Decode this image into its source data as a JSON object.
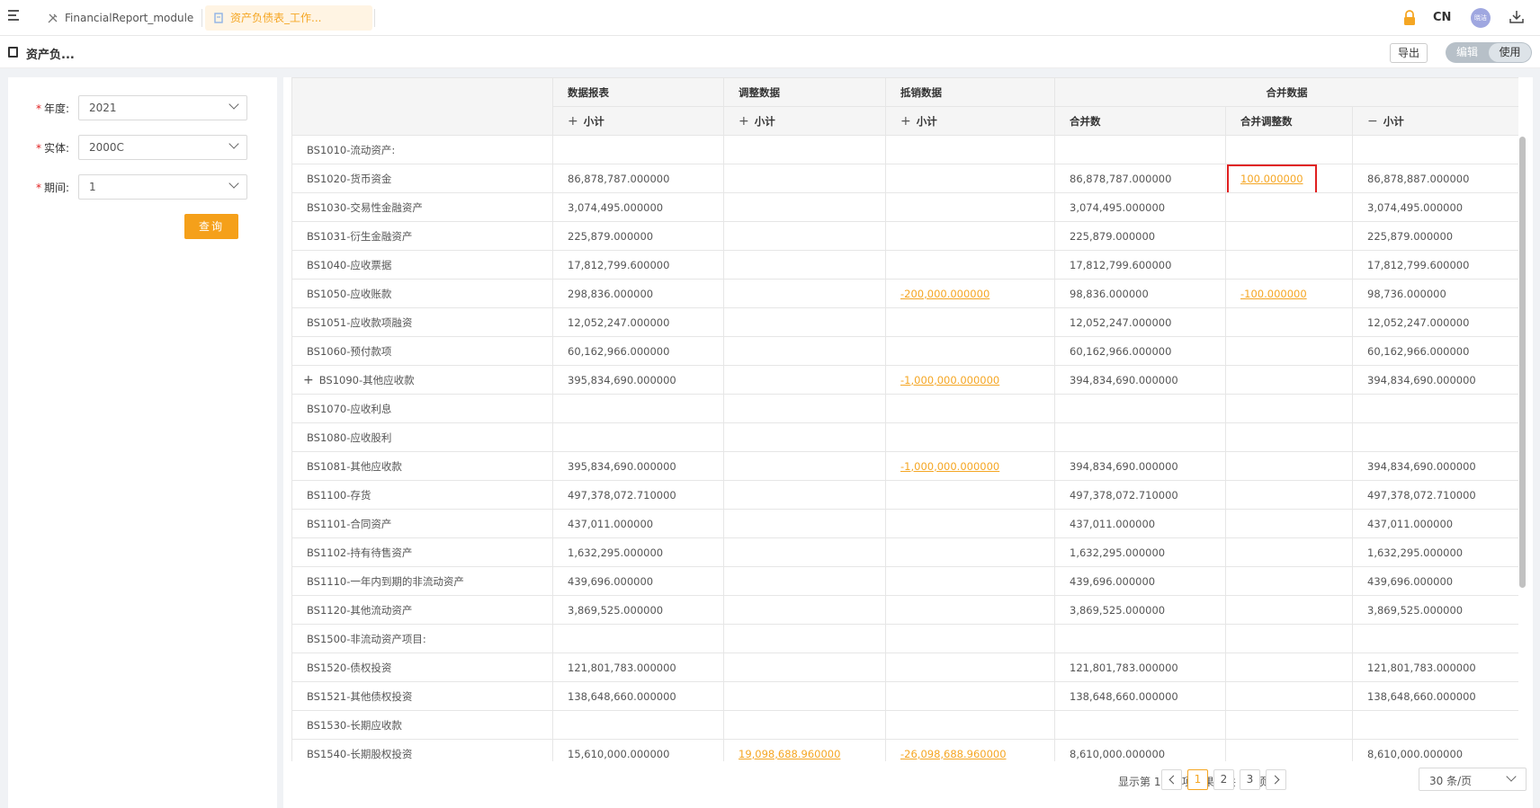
{
  "tabs": [
    {
      "label": "FinancialReport_module"
    },
    {
      "label": "资产负债表_工作..."
    }
  ],
  "header": {
    "lang": "CN",
    "avatar_text": "晓洁"
  },
  "subbar": {
    "title": "资产负...",
    "export_label": "导出",
    "mode_edit": "编辑",
    "mode_use": "使用"
  },
  "filters": [
    {
      "label": "年度:",
      "value": "2021"
    },
    {
      "label": "实体:",
      "value": "2000C"
    },
    {
      "label": "期间:",
      "value": "1"
    }
  ],
  "query_label": "查询",
  "table": {
    "group_headers": {
      "report": "数据报表",
      "adjust": "调整数据",
      "offset": "抵销数据",
      "consolidated": "合并数据"
    },
    "sub_headers": {
      "report_subtotal": "小计",
      "adjust_subtotal": "小计",
      "offset_subtotal": "小计",
      "consolidated_num": "合并数",
      "consolidated_adjust": "合并调整数",
      "consolidated_subtotal": "小计"
    },
    "rows": [
      {
        "account": "BS1010-流动资产:",
        "report": "",
        "adjust": "",
        "offset": "",
        "cons": "",
        "cons_adj": "",
        "subtotal": ""
      },
      {
        "account": "BS1020-货币资金",
        "report": "86,878,787.000000",
        "adjust": "",
        "offset": "",
        "cons": "86,878,787.000000",
        "cons_adj": "100.000000",
        "subtotal": "86,878,887.000000"
      },
      {
        "account": "BS1030-交易性金融资产",
        "report": "3,074,495.000000",
        "adjust": "",
        "offset": "",
        "cons": "3,074,495.000000",
        "cons_adj": "",
        "subtotal": "3,074,495.000000"
      },
      {
        "account": "BS1031-衍生金融资产",
        "report": "225,879.000000",
        "adjust": "",
        "offset": "",
        "cons": "225,879.000000",
        "cons_adj": "",
        "subtotal": "225,879.000000"
      },
      {
        "account": "BS1040-应收票据",
        "report": "17,812,799.600000",
        "adjust": "",
        "offset": "",
        "cons": "17,812,799.600000",
        "cons_adj": "",
        "subtotal": "17,812,799.600000"
      },
      {
        "account": "BS1050-应收账款",
        "report": "298,836.000000",
        "adjust": "",
        "offset": "-200,000.000000",
        "cons": "98,836.000000",
        "cons_adj": "-100.000000",
        "subtotal": "98,736.000000"
      },
      {
        "account": "BS1051-应收款项融资",
        "report": "12,052,247.000000",
        "adjust": "",
        "offset": "",
        "cons": "12,052,247.000000",
        "cons_adj": "",
        "subtotal": "12,052,247.000000"
      },
      {
        "account": "BS1060-预付款项",
        "report": "60,162,966.000000",
        "adjust": "",
        "offset": "",
        "cons": "60,162,966.000000",
        "cons_adj": "",
        "subtotal": "60,162,966.000000"
      },
      {
        "account": "BS1090-其他应收款",
        "expandable": true,
        "report": "395,834,690.000000",
        "adjust": "",
        "offset": "-1,000,000.000000",
        "cons": "394,834,690.000000",
        "cons_adj": "",
        "subtotal": "394,834,690.000000"
      },
      {
        "account": "BS1070-应收利息",
        "report": "",
        "adjust": "",
        "offset": "",
        "cons": "",
        "cons_adj": "",
        "subtotal": ""
      },
      {
        "account": "BS1080-应收股利",
        "report": "",
        "adjust": "",
        "offset": "",
        "cons": "",
        "cons_adj": "",
        "subtotal": ""
      },
      {
        "account": "BS1081-其他应收款",
        "report": "395,834,690.000000",
        "adjust": "",
        "offset": "-1,000,000.000000",
        "cons": "394,834,690.000000",
        "cons_adj": "",
        "subtotal": "394,834,690.000000"
      },
      {
        "account": "BS1100-存货",
        "report": "497,378,072.710000",
        "adjust": "",
        "offset": "",
        "cons": "497,378,072.710000",
        "cons_adj": "",
        "subtotal": "497,378,072.710000"
      },
      {
        "account": "BS1101-合同资产",
        "report": "437,011.000000",
        "adjust": "",
        "offset": "",
        "cons": "437,011.000000",
        "cons_adj": "",
        "subtotal": "437,011.000000"
      },
      {
        "account": "BS1102-持有待售资产",
        "report": "1,632,295.000000",
        "adjust": "",
        "offset": "",
        "cons": "1,632,295.000000",
        "cons_adj": "",
        "subtotal": "1,632,295.000000"
      },
      {
        "account": "BS1110-一年内到期的非流动资产",
        "report": "439,696.000000",
        "adjust": "",
        "offset": "",
        "cons": "439,696.000000",
        "cons_adj": "",
        "subtotal": "439,696.000000"
      },
      {
        "account": "BS1120-其他流动资产",
        "report": "3,869,525.000000",
        "adjust": "",
        "offset": "",
        "cons": "3,869,525.000000",
        "cons_adj": "",
        "subtotal": "3,869,525.000000"
      },
      {
        "account": "BS1500-非流动资产项目:",
        "report": "",
        "adjust": "",
        "offset": "",
        "cons": "",
        "cons_adj": "",
        "subtotal": ""
      },
      {
        "account": "BS1520-债权投资",
        "report": "121,801,783.000000",
        "adjust": "",
        "offset": "",
        "cons": "121,801,783.000000",
        "cons_adj": "",
        "subtotal": "121,801,783.000000"
      },
      {
        "account": "BS1521-其他债权投资",
        "report": "138,648,660.000000",
        "adjust": "",
        "offset": "",
        "cons": "138,648,660.000000",
        "cons_adj": "",
        "subtotal": "138,648,660.000000"
      },
      {
        "account": "BS1530-长期应收款",
        "report": "",
        "adjust": "",
        "offset": "",
        "cons": "",
        "cons_adj": "",
        "subtotal": ""
      },
      {
        "account": "BS1540-长期股权投资",
        "report": "15,610,000.000000",
        "adjust": "19,098,688.960000",
        "offset": "-26,098,688.960000",
        "cons": "8,610,000.000000",
        "cons_adj": "",
        "subtotal": "8,610,000.000000"
      }
    ]
  },
  "pagination": {
    "info": "显示第 1-30 项结果，共 86 项",
    "pages": [
      "1",
      "2",
      "3"
    ],
    "current": "1",
    "page_size": "30 条/页"
  },
  "colors": {
    "accent": "#f5a623",
    "highlight_box": "#e02020"
  }
}
